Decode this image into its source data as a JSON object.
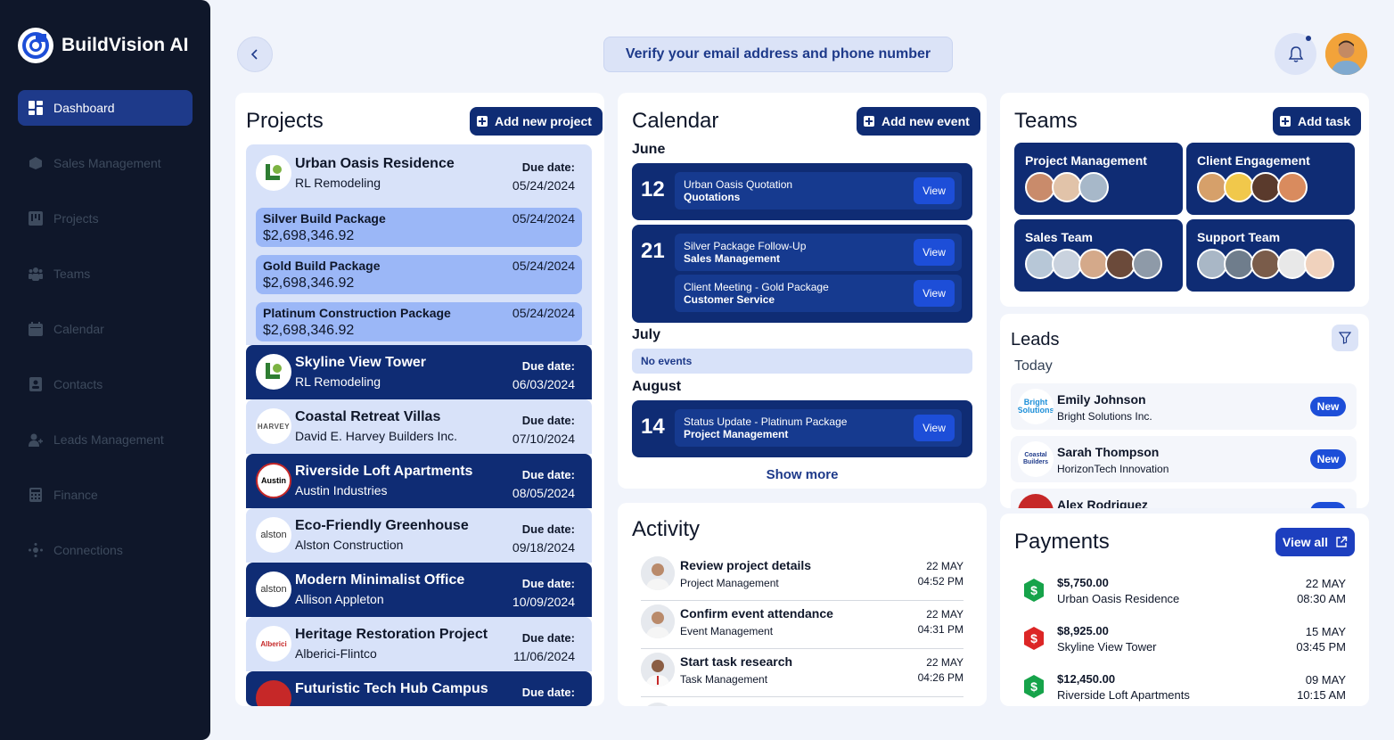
{
  "brand": {
    "name": "BuildVision AI"
  },
  "sidebar": {
    "items": [
      {
        "label": "Dashboard",
        "icon": "grid-icon",
        "active": true
      },
      {
        "label": "Sales Management",
        "icon": "gauge-icon"
      },
      {
        "label": "Projects",
        "icon": "kanban-icon"
      },
      {
        "label": "Teams",
        "icon": "people-icon"
      },
      {
        "label": "Calendar",
        "icon": "calendar-icon"
      },
      {
        "label": "Contacts",
        "icon": "contact-card-icon"
      },
      {
        "label": "Leads Management",
        "icon": "person-add-icon"
      },
      {
        "label": "Finance",
        "icon": "calculator-icon"
      },
      {
        "label": "Connections",
        "icon": "network-icon"
      }
    ]
  },
  "header": {
    "verify_text": "Verify your email address and phone number"
  },
  "projects": {
    "title": "Projects",
    "add_label": "Add new project",
    "expanded": {
      "name": "Urban Oasis Residence",
      "company": "RL Remodeling",
      "due_label": "Due date:",
      "due": "05/24/2024",
      "packages": [
        {
          "name": "Silver Build Package",
          "price": "$2,698,346.92",
          "date": "05/24/2024"
        },
        {
          "name": "Gold Build Package",
          "price": "$2,698,346.92",
          "date": "05/24/2024"
        },
        {
          "name": "Platinum Construction Package",
          "price": "$2,698,346.92",
          "date": "05/24/2024"
        }
      ]
    },
    "rows": [
      {
        "name": "Skyline View Tower",
        "company": "RL Remodeling",
        "due_label": "Due date:",
        "due": "06/03/2024",
        "theme": "dark",
        "logo": "RL"
      },
      {
        "name": "Coastal Retreat Villas",
        "company": "David E. Harvey Builders Inc.",
        "due_label": "Due date:",
        "due": "07/10/2024",
        "theme": "light",
        "logo": "HARVEY"
      },
      {
        "name": "Riverside Loft Apartments",
        "company": "Austin Industries",
        "due_label": "Due date:",
        "due": "08/05/2024",
        "theme": "dark",
        "logo": "Austin"
      },
      {
        "name": "Eco-Friendly Greenhouse",
        "company": "Alston Construction",
        "due_label": "Due date:",
        "due": "09/18/2024",
        "theme": "light",
        "logo": "alston"
      },
      {
        "name": "Modern Minimalist Office",
        "company": "Allison Appleton",
        "due_label": "Due date:",
        "due": "10/09/2024",
        "theme": "dark",
        "logo": "alston"
      },
      {
        "name": "Heritage Restoration Project",
        "company": "Alberici-Flintco",
        "due_label": "Due date:",
        "due": "11/06/2024",
        "theme": "light",
        "logo": "Alberici"
      },
      {
        "name": "Futuristic Tech Hub Campus",
        "company": "",
        "due_label": "Due date:",
        "due": "",
        "theme": "dark",
        "logo": ""
      }
    ]
  },
  "calendar": {
    "title": "Calendar",
    "add_label": "Add new event",
    "months": [
      "June",
      "July",
      "August"
    ],
    "days": [
      {
        "day": "12",
        "events": [
          {
            "title": "Urban Oasis Quotation",
            "sub": "Quotations"
          }
        ]
      },
      {
        "day": "21",
        "events": [
          {
            "title": "Silver Package Follow-Up",
            "sub": "Sales Management"
          },
          {
            "title": "Client Meeting - Gold Package",
            "sub": "Customer Service"
          }
        ]
      },
      {
        "day": "14",
        "events": [
          {
            "title": "Status Update - Platinum Package",
            "sub": "Project Management"
          }
        ]
      }
    ],
    "no_events": "No events",
    "view_label": "View",
    "show_more": "Show more"
  },
  "activity": {
    "title": "Activity",
    "items": [
      {
        "title": "Review project details",
        "sub": "Project Management",
        "date": "22 MAY",
        "time": "04:52 PM"
      },
      {
        "title": "Confirm event attendance",
        "sub": "Event Management",
        "date": "22 MAY",
        "time": "04:31 PM"
      },
      {
        "title": "Start task research",
        "sub": "Task Management",
        "date": "22 MAY",
        "time": "04:26 PM"
      }
    ]
  },
  "teams": {
    "title": "Teams",
    "add_label": "Add task",
    "items": [
      {
        "name": "Project Management",
        "members": 3
      },
      {
        "name": "Client Engagement",
        "members": 4
      },
      {
        "name": "Sales Team",
        "members": 5
      },
      {
        "name": "Support Team",
        "members": 5
      }
    ]
  },
  "leads": {
    "title": "Leads",
    "today": "Today",
    "items": [
      {
        "name": "Emily Johnson",
        "company": "Bright Solutions Inc.",
        "badge": "New",
        "logo": "Bright Solutions"
      },
      {
        "name": "Sarah Thompson",
        "company": "HorizonTech Innovation",
        "badge": "New",
        "logo": "Coastal Builders"
      },
      {
        "name": "Alex Rodriguez",
        "company": "",
        "badge": "",
        "logo": ""
      }
    ]
  },
  "payments": {
    "title": "Payments",
    "view_all": "View all",
    "items": [
      {
        "amount": "$5,750.00",
        "name": "Urban Oasis Residence",
        "date": "22 MAY",
        "time": "08:30 AM",
        "color": "#16a34a"
      },
      {
        "amount": "$8,925.00",
        "name": "Skyline View Tower",
        "date": "15 MAY",
        "time": "03:45 PM",
        "color": "#dc2626"
      },
      {
        "amount": "$12,450.00",
        "name": "Riverside Loft Apartments",
        "date": "09 MAY",
        "time": "10:15 AM",
        "color": "#16a34a"
      }
    ]
  },
  "colors": {
    "navy": "#0f2c74",
    "sidebar": "#0f172a",
    "accent": "#1d4ed8",
    "light_blue": "#d8e2f9"
  }
}
